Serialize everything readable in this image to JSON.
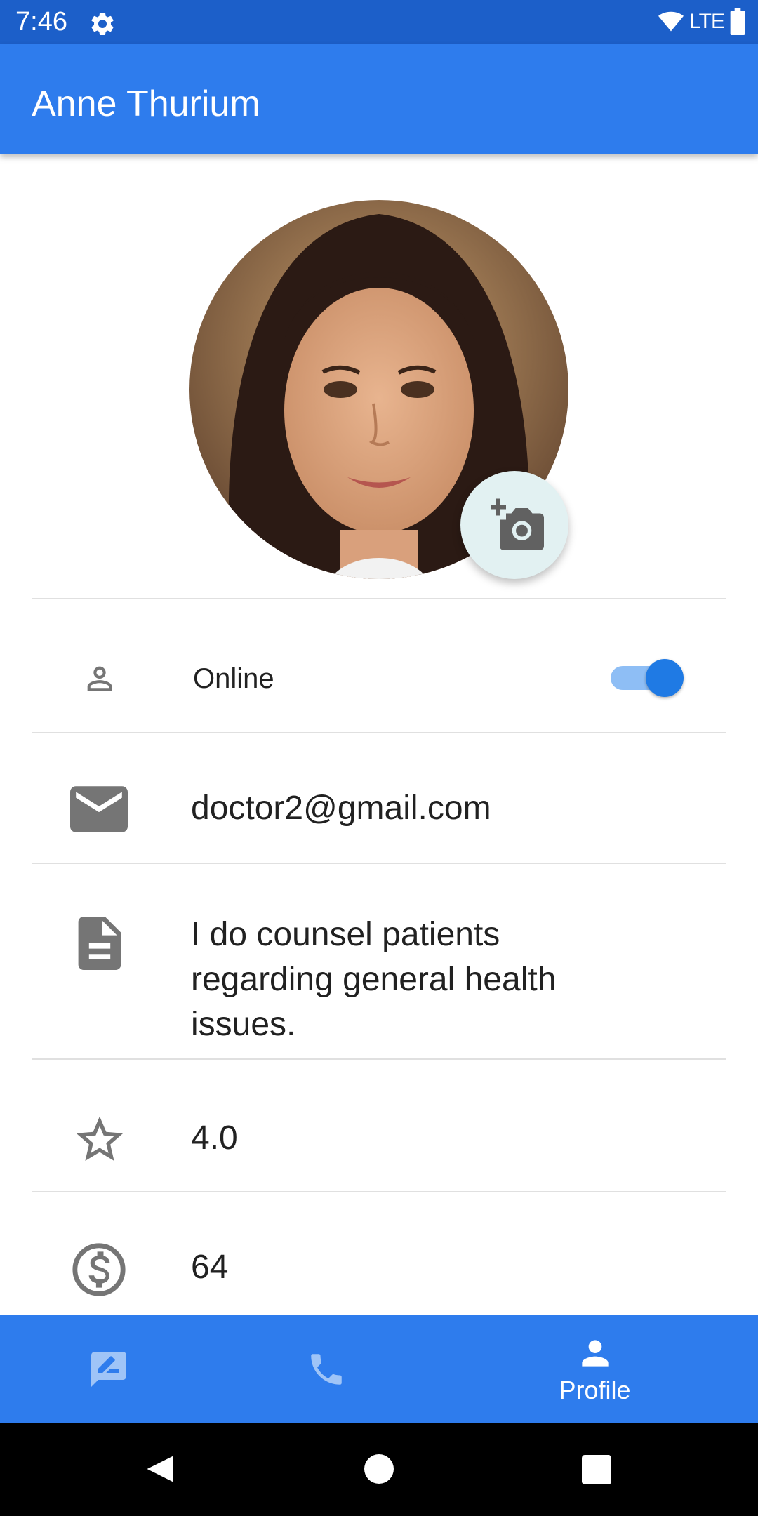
{
  "status": {
    "time": "7:46",
    "network": "LTE"
  },
  "app": {
    "title": "Anne Thurium"
  },
  "profile": {
    "online_label": "Online",
    "online": true,
    "email": "doctor2@gmail.com",
    "bio": "I do counsel patients regarding general health issues.",
    "rating": "4.0",
    "fee": "64"
  },
  "nav": {
    "profile_label": "Profile"
  },
  "colors": {
    "primary": "#2e7ced",
    "status_bar": "#1c5fc9",
    "accent": "#1f7ae4",
    "icon_grey": "#757575"
  }
}
